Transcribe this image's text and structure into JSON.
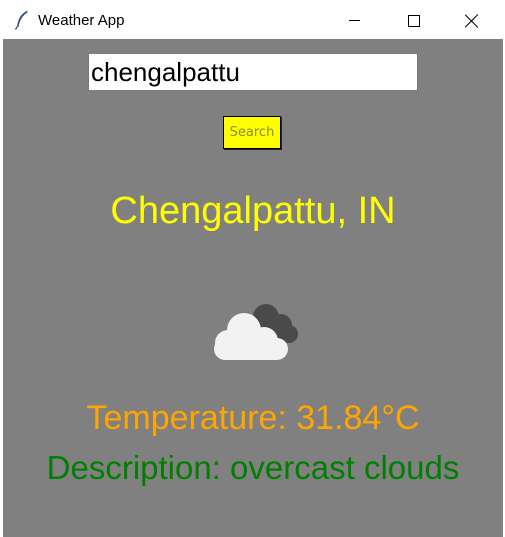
{
  "window": {
    "title": "Weather App",
    "icon": "feather-icon",
    "controls": [
      "minimize-icon",
      "maximize-icon",
      "close-icon"
    ]
  },
  "search": {
    "value": "chengalpattu",
    "button_label": "Search"
  },
  "result": {
    "location": "Chengalpattu, IN",
    "icon": "overcast-clouds-icon",
    "temperature": "Temperature: 31.84°C",
    "description": "Description: overcast clouds"
  },
  "colors": {
    "background": "#808080",
    "location": "#ffff00",
    "temperature": "#ffa500",
    "description": "#008000",
    "button": "#ffff00"
  }
}
